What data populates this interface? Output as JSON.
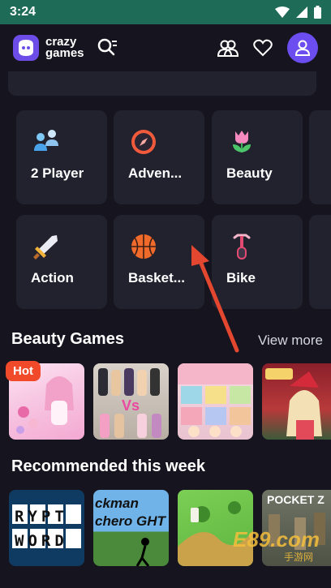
{
  "status_bar": {
    "time": "3:24"
  },
  "header": {
    "logo_text_1": "crazy",
    "logo_text_2": "games",
    "icons": [
      "logo-icon",
      "search-icon",
      "friends-icon",
      "heart-icon",
      "profile-icon"
    ]
  },
  "categories": [
    {
      "label": "2 Player",
      "icon": "two-player-icon"
    },
    {
      "label": "Adven...",
      "icon": "compass-icon"
    },
    {
      "label": "Beauty",
      "icon": "tulip-icon"
    },
    {
      "label": "Action",
      "icon": "sword-icon"
    },
    {
      "label": "Basket...",
      "icon": "basketball-icon"
    },
    {
      "label": "Bike",
      "icon": "bike-icon"
    }
  ],
  "beauty_section": {
    "title": "Beauty Games",
    "view_more": "View more",
    "hot_badge": "Hot"
  },
  "recommended_section": {
    "title": "Recommended this week",
    "thumbs_text": [
      "RYPT WORD",
      "ckman chero GHT",
      "",
      "POCKET Z"
    ]
  },
  "watermark": {
    "main": "E89.com",
    "sub": "手游网"
  },
  "colors": {
    "status_bar": "#1e6b58",
    "background": "#16151f",
    "tile": "#22212e",
    "accent": "#6c4df0",
    "hot": "#f04a2a",
    "arrow": "#e3472f"
  }
}
